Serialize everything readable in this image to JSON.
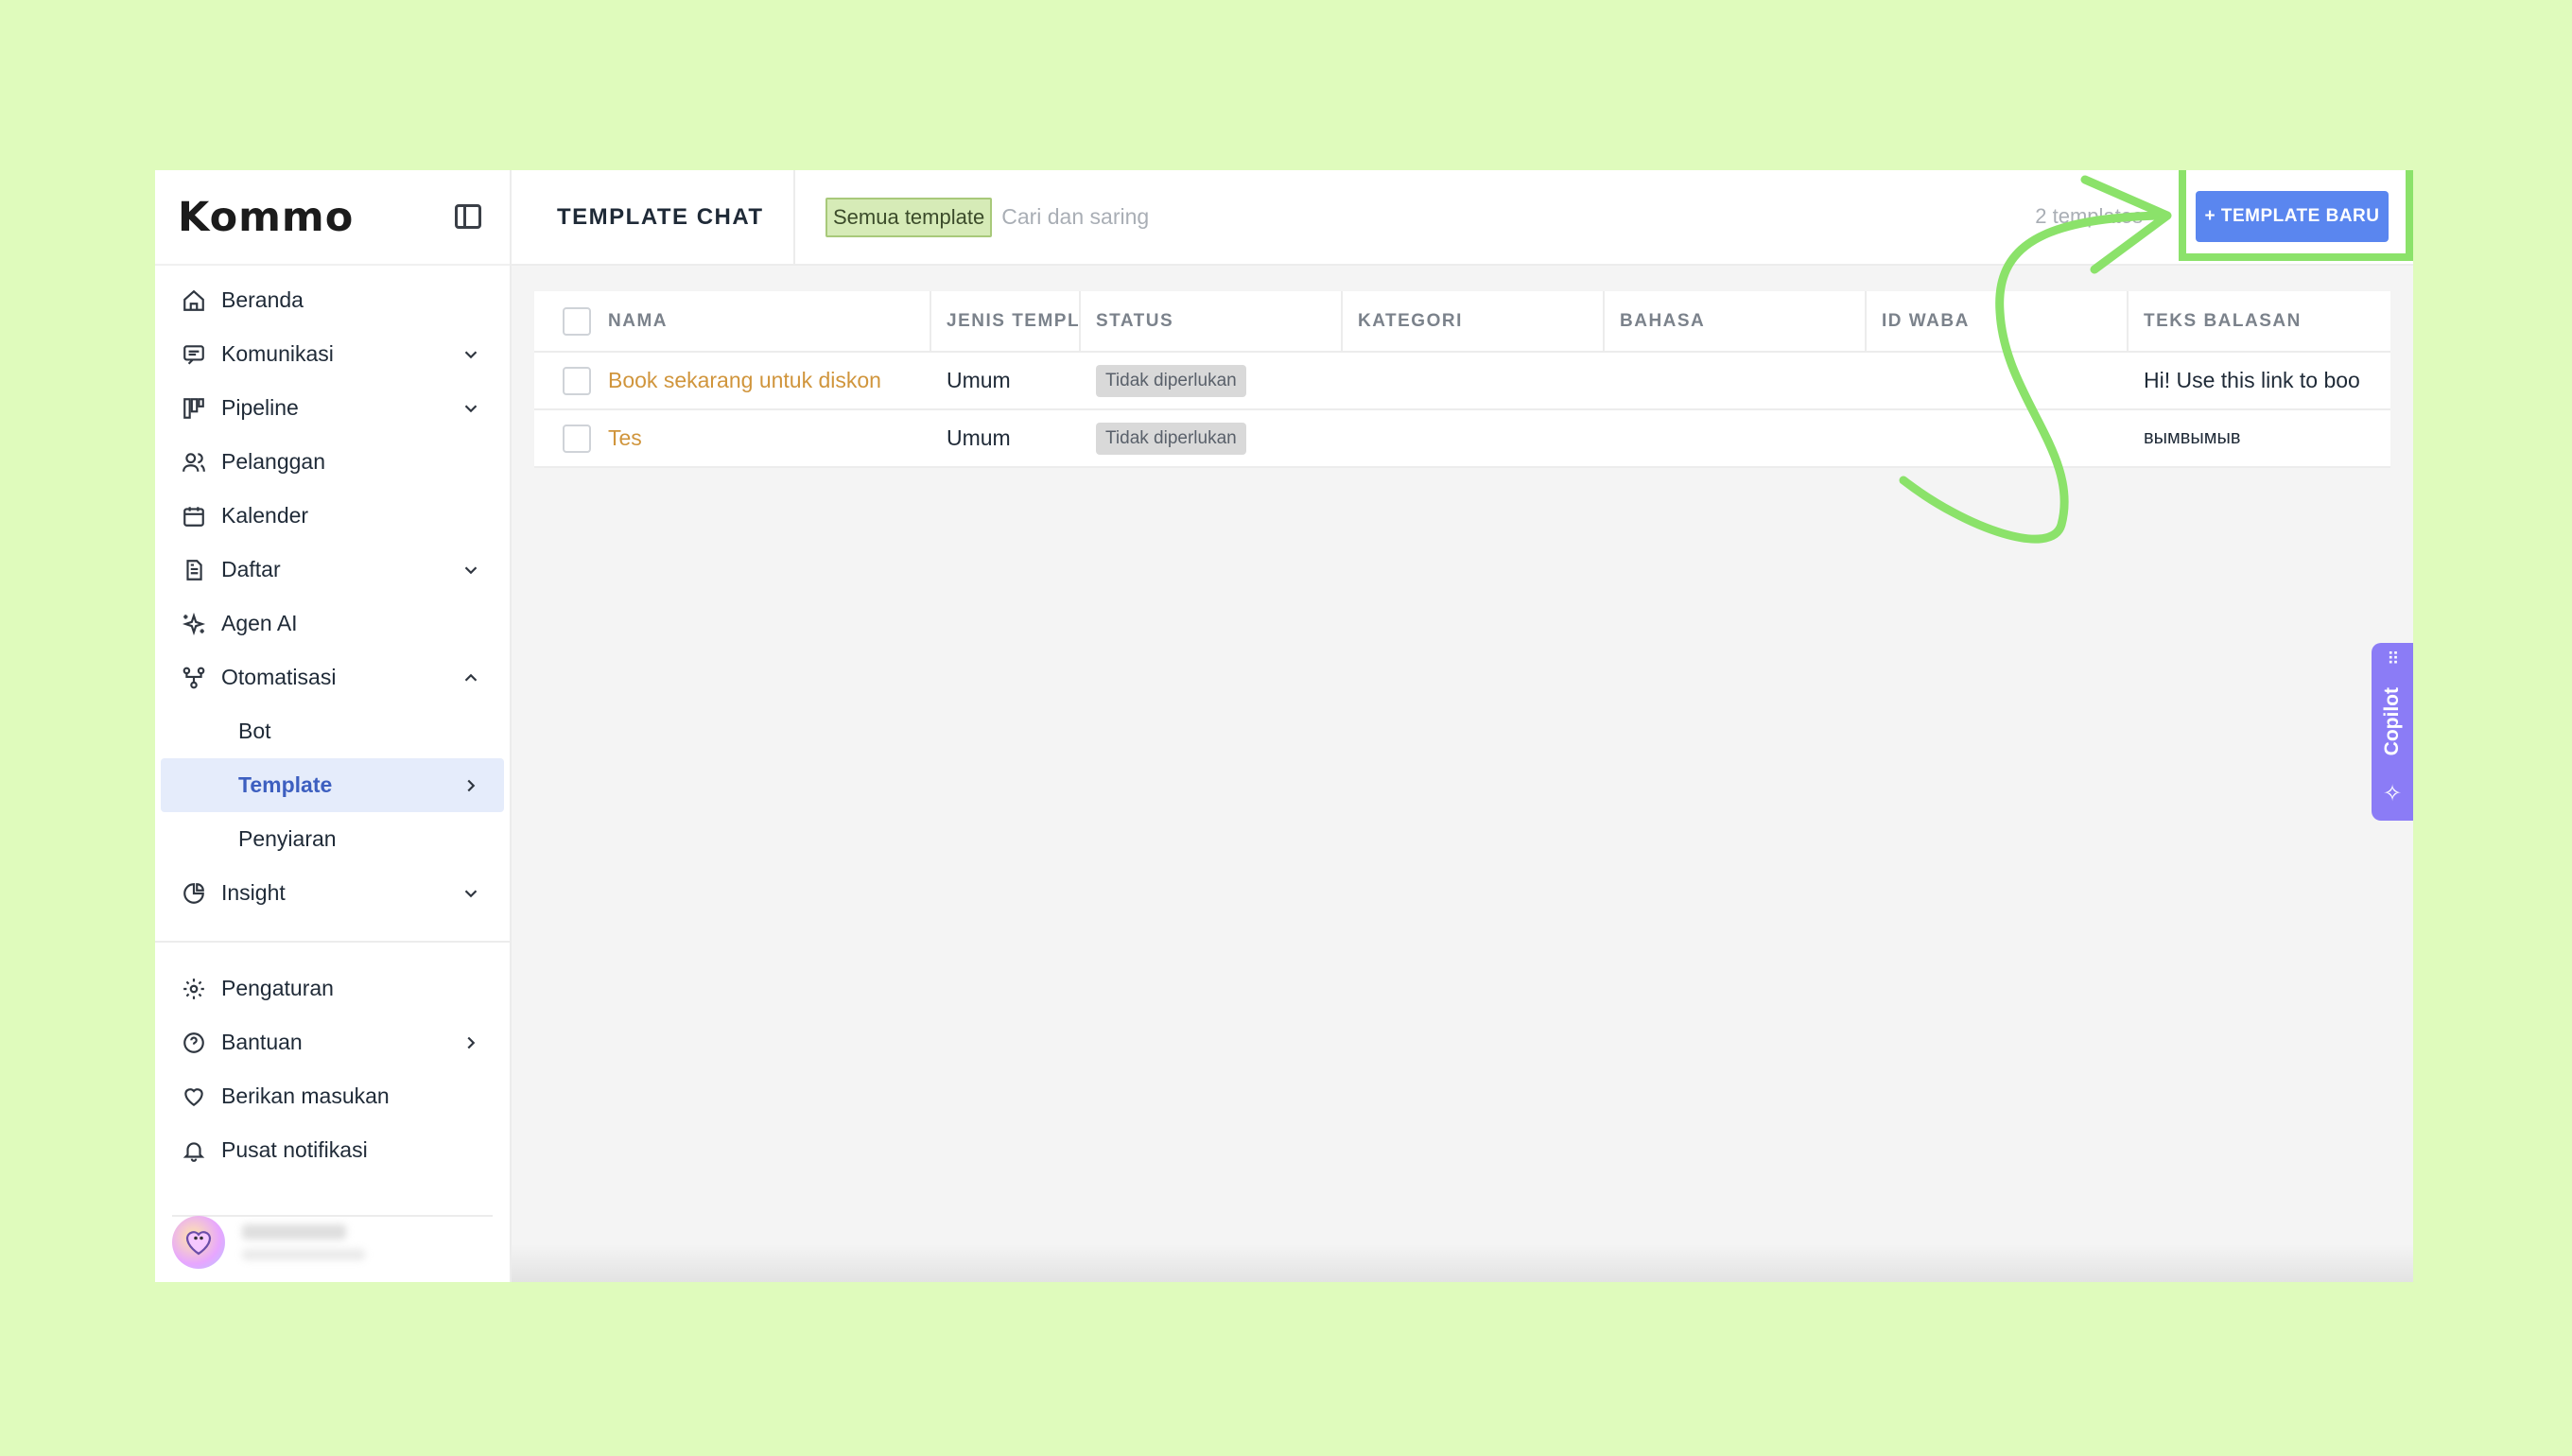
{
  "brand": {
    "logo_text": "Kommo"
  },
  "sidebar": {
    "items": [
      {
        "label": "Beranda",
        "icon": "home-icon"
      },
      {
        "label": "Komunikasi",
        "icon": "chat-icon",
        "chevron": "down"
      },
      {
        "label": "Pipeline",
        "icon": "pipeline-icon",
        "chevron": "down"
      },
      {
        "label": "Pelanggan",
        "icon": "users-icon"
      },
      {
        "label": "Kalender",
        "icon": "calendar-icon"
      },
      {
        "label": "Daftar",
        "icon": "document-icon",
        "chevron": "down"
      },
      {
        "label": "Agen AI",
        "icon": "sparkle-icon"
      },
      {
        "label": "Otomatisasi",
        "icon": "automation-icon",
        "chevron": "up"
      }
    ],
    "sub_items": [
      {
        "label": "Bot"
      },
      {
        "label": "Template",
        "active": true
      },
      {
        "label": "Penyiaran"
      }
    ],
    "insight": {
      "label": "Insight",
      "icon": "pie-chart-icon"
    },
    "bottom_items": [
      {
        "label": "Pengaturan",
        "icon": "gear-icon"
      },
      {
        "label": "Bantuan",
        "icon": "help-icon"
      },
      {
        "label": "Berikan masukan",
        "icon": "heart-icon"
      },
      {
        "label": "Pusat notifikasi",
        "icon": "bell-icon"
      }
    ]
  },
  "header": {
    "title": "TEMPLATE CHAT",
    "filter_chip": "Semua template",
    "search_placeholder": "Cari dan saring",
    "count": "2 templates",
    "new_button": "+ TEMPLATE BARU"
  },
  "table": {
    "columns": [
      "NAMA",
      "JENIS TEMPLA",
      "STATUS",
      "KATEGORI",
      "BAHASA",
      "ID WABA",
      "TEKS BALASAN"
    ],
    "rows": [
      {
        "name": "Book sekarang untuk diskon",
        "type": "Umum",
        "status": "Tidak diperlukan",
        "category": "",
        "language": "",
        "waba": "",
        "reply": "Hi! Use this link to boo"
      },
      {
        "name": "Tes",
        "type": "Umum",
        "status": "Tidak diperlukan",
        "category": "",
        "language": "",
        "waba": "",
        "reply": "вымвымыв"
      }
    ]
  },
  "copilot": {
    "label": "Copilot"
  },
  "colors": {
    "background": "#dffbbc",
    "accent": "#5a86ef",
    "highlight": "#8be26a",
    "link": "#d0953c",
    "copilot": "#8b7cf6"
  }
}
